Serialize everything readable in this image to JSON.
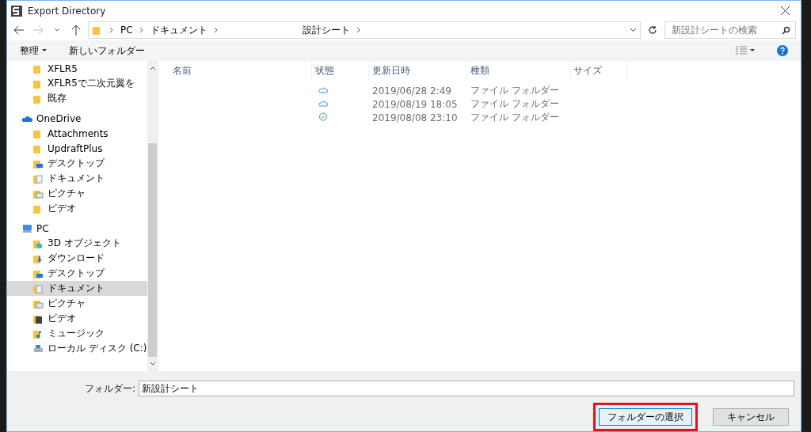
{
  "window": {
    "title": "Export Directory"
  },
  "address_bar": {
    "segments": [
      "PC",
      "ドキュメント",
      "設計シート"
    ]
  },
  "search": {
    "placeholder": "新設計シートの検索"
  },
  "toolbar": {
    "organize": "整理",
    "new_folder": "新しいフォルダー"
  },
  "sidebar": {
    "items": [
      {
        "children": [
          {
            "label": "XFLR5",
            "kind": "folder",
            "selected": false
          },
          {
            "label": "XFLR5で二次元翼を",
            "kind": "folder",
            "selected": false
          },
          {
            "label": "既存",
            "kind": "folder",
            "selected": false
          }
        ]
      },
      {
        "label": "OneDrive",
        "kind": "cloud",
        "selected": false,
        "children": [
          {
            "label": "Attachments",
            "kind": "folder",
            "selected": false
          },
          {
            "label": "UpdraftPlus",
            "kind": "folder",
            "selected": false
          },
          {
            "label": "デスクトップ",
            "kind": "desktop",
            "selected": false
          },
          {
            "label": "ドキュメント",
            "kind": "document",
            "selected": false
          },
          {
            "label": "ピクチャ",
            "kind": "picture",
            "selected": false
          },
          {
            "label": "ビデオ",
            "kind": "folder",
            "selected": false
          }
        ]
      },
      {
        "label": "PC",
        "kind": "computer",
        "selected": false,
        "children": [
          {
            "label": "3D オブジェクト",
            "kind": "cube",
            "selected": false
          },
          {
            "label": "ダウンロード",
            "kind": "download",
            "selected": false
          },
          {
            "label": "デスクトップ",
            "kind": "desktop",
            "selected": false
          },
          {
            "label": "ドキュメント",
            "kind": "document",
            "selected": true
          },
          {
            "label": "ピクチャ",
            "kind": "picture",
            "selected": false
          },
          {
            "label": "ビデオ",
            "kind": "film",
            "selected": false
          },
          {
            "label": "ミュージック",
            "kind": "music",
            "selected": false
          },
          {
            "label": "ローカル ディスク (C:)",
            "kind": "drive",
            "selected": false
          }
        ]
      }
    ]
  },
  "table": {
    "columns": [
      "名前",
      "状態",
      "更新日時",
      "種類",
      "サイズ"
    ],
    "rows": [
      {
        "kind": "cloud",
        "modified": "2019/06/28 2:49",
        "type": "ファイル フォルダー"
      },
      {
        "kind": "cloud",
        "modified": "2019/08/19 18:05",
        "type": "ファイル フォルダー"
      },
      {
        "kind": "synced",
        "modified": "2019/08/08 23:10",
        "type": "ファイル フォルダー"
      }
    ]
  },
  "folder_field": {
    "label": "フォルダー:",
    "value": "新設計シート"
  },
  "buttons": [
    {
      "label": "フォルダーの選択",
      "highlighted": true
    },
    {
      "label": "キャンセル",
      "highlighted": false
    }
  ]
}
